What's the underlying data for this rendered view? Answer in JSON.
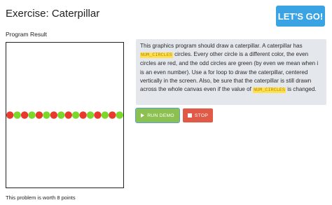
{
  "header": {
    "title": "Exercise: Caterpillar",
    "lets_go_label": "LET'S GO!"
  },
  "program": {
    "label": "Program Result",
    "num_circles": 16,
    "colors": {
      "even": "#e8392c",
      "odd": "#7bd82b"
    }
  },
  "instructions": {
    "text_1": "This graphics program should draw a caterpillar. A caterpillar has ",
    "code_1": "NUM_CIRCLES",
    "text_2": " circles. Every other circle is a different color, the even circles are red, and the odd circles are green (by even we mean when i is an even number). Use a for loop to draw the caterpillar, centered vertically in the screen. Also, be sure that the caterpillar is still drawn across the whole canvas even if the value of ",
    "code_2": "NUM_CIRCLES",
    "text_3": " is changed."
  },
  "buttons": {
    "run_label": "RUN DEMO",
    "stop_label": "STOP"
  },
  "footer": {
    "note": "This problem is worth 8 points"
  }
}
